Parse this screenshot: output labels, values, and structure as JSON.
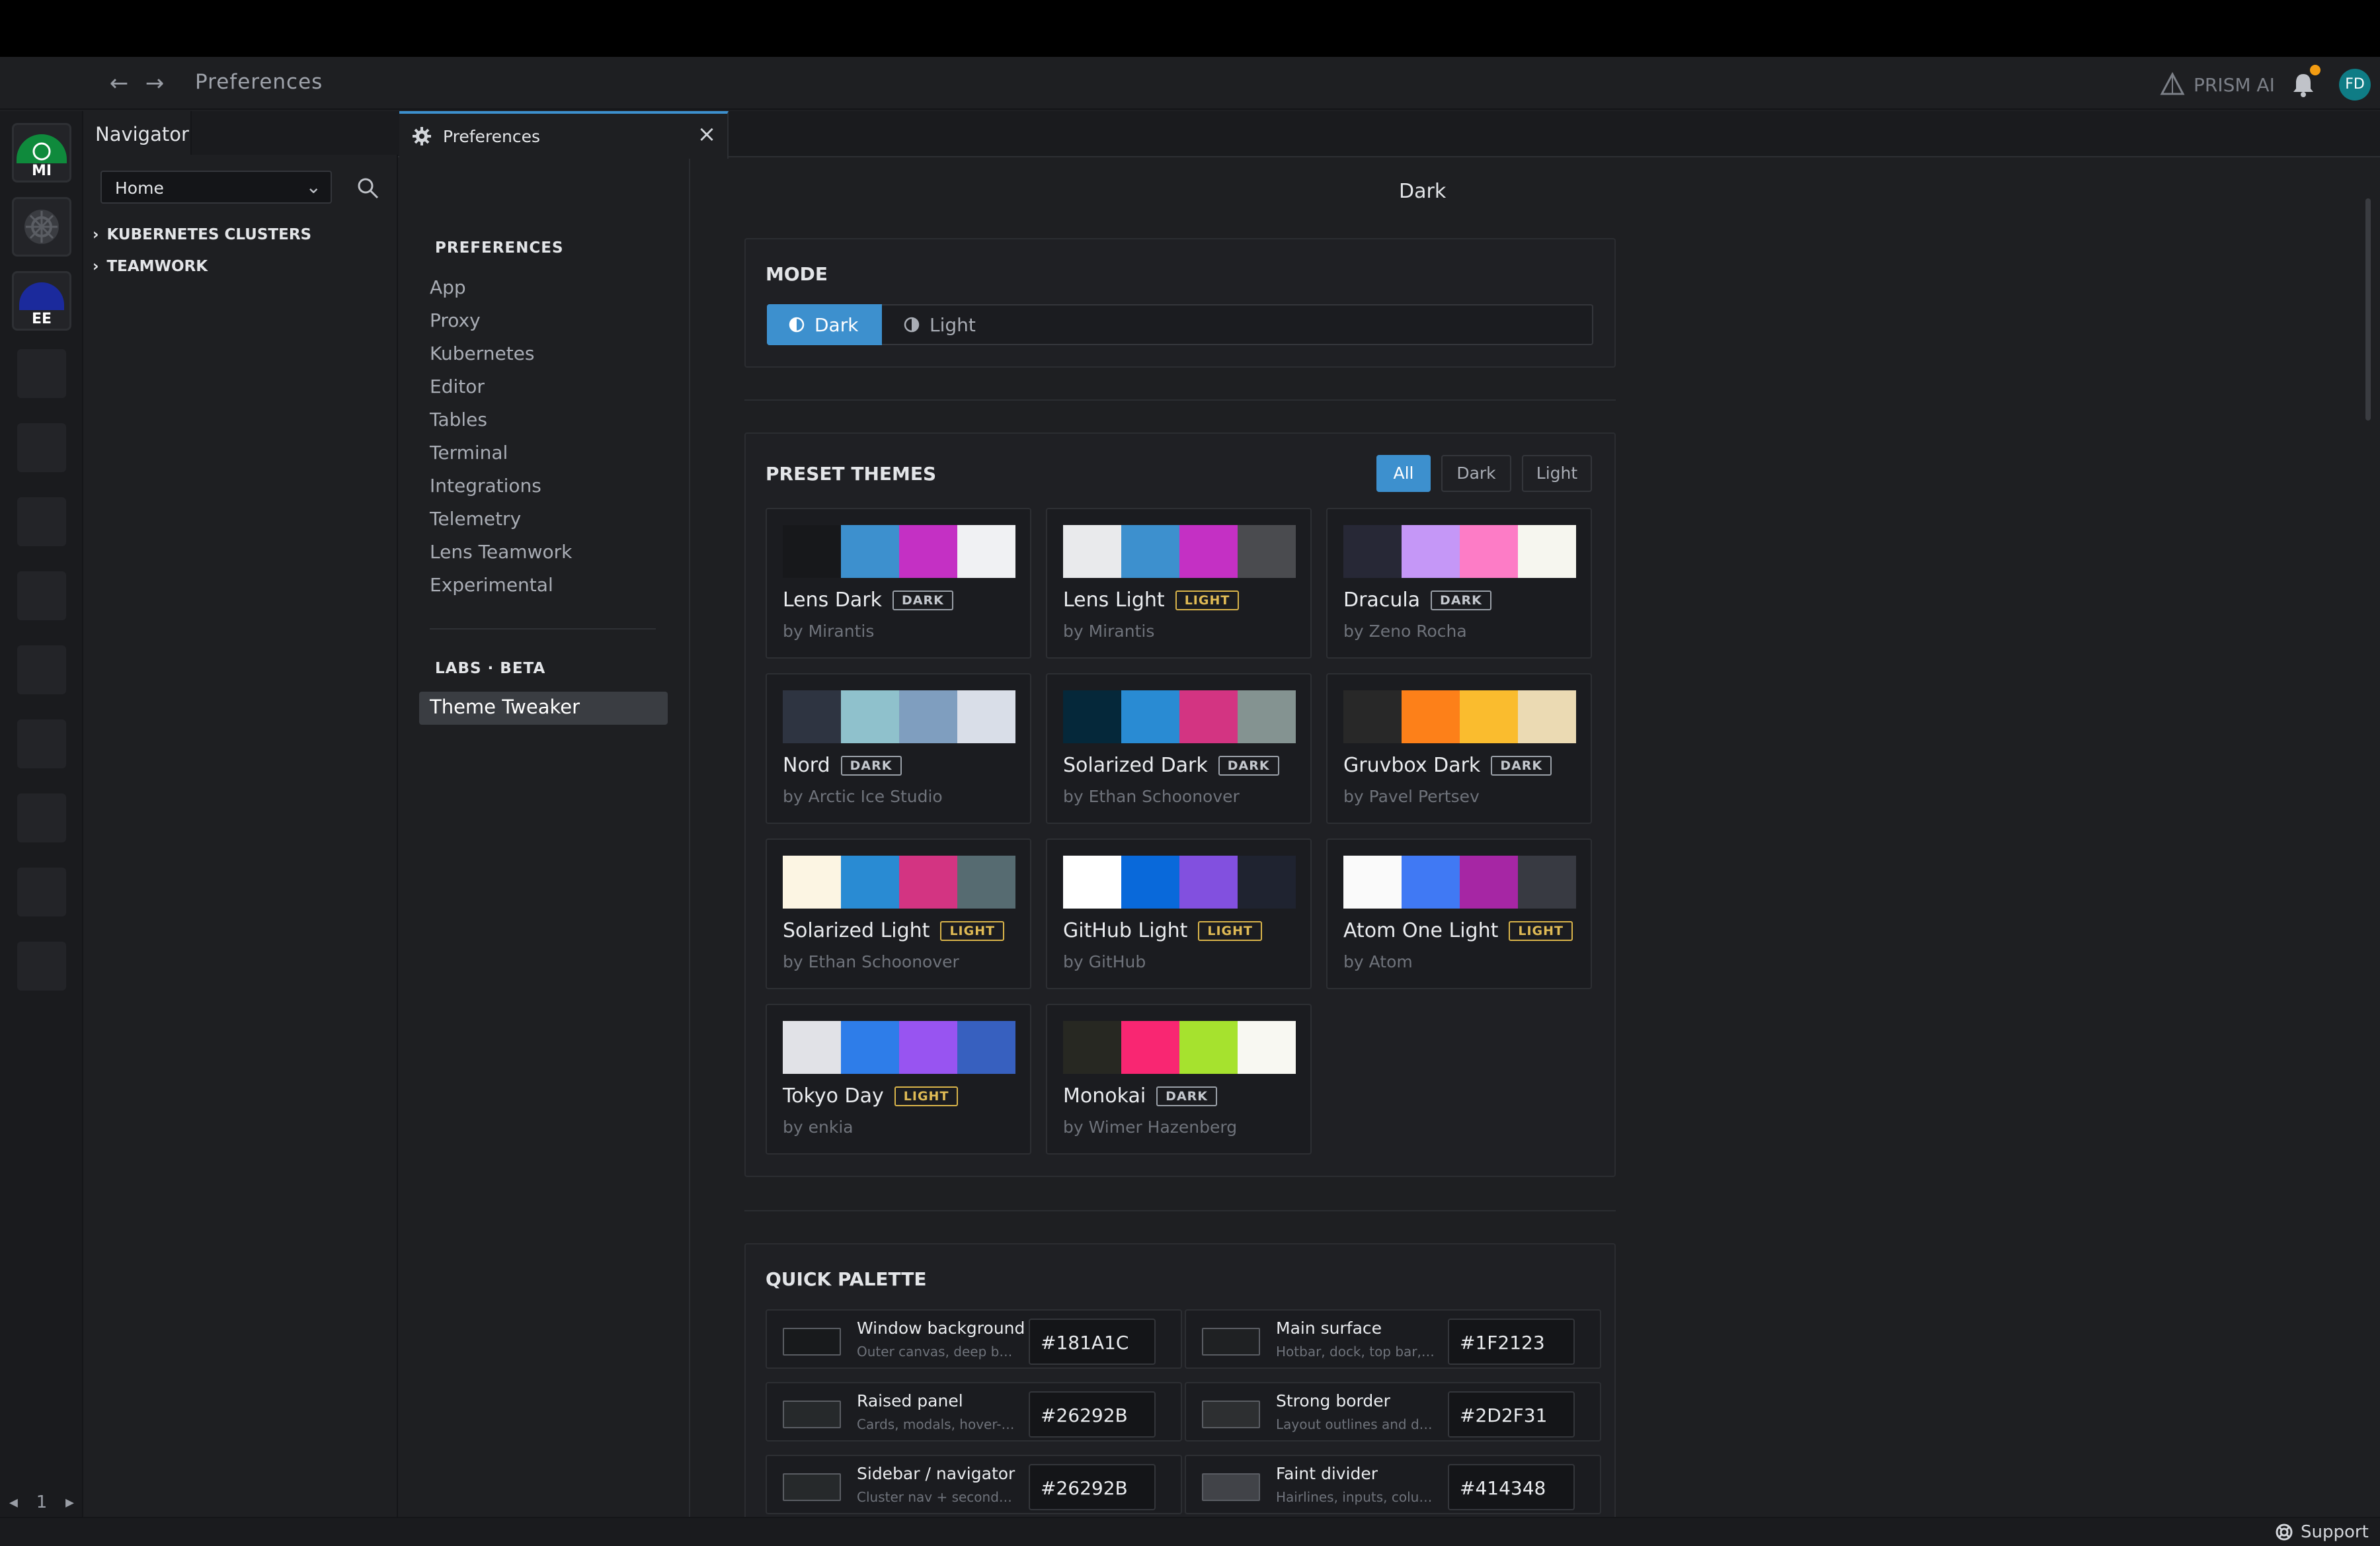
{
  "header": {
    "breadcrumb": "Preferences",
    "ai_label": "PRISM AI",
    "avatar_initials": "FD"
  },
  "hotbar": {
    "items": [
      {
        "label": "MI"
      },
      {
        "label": ""
      },
      {
        "label": "EE"
      }
    ],
    "page": "1"
  },
  "navigator": {
    "tab_label": "Navigator",
    "select_value": "Home",
    "tree": [
      "KUBERNETES CLUSTERS",
      "TEAMWORK"
    ]
  },
  "tab": {
    "label": "Preferences"
  },
  "pref_menu": {
    "section_title": "PREFERENCES",
    "items": [
      "App",
      "Proxy",
      "Kubernetes",
      "Editor",
      "Tables",
      "Terminal",
      "Integrations",
      "Telemetry",
      "Lens Teamwork",
      "Experimental"
    ],
    "labs_title": "LABS · BETA",
    "labs_item": "Theme Tweaker"
  },
  "content": {
    "title": "Dark",
    "mode": {
      "title": "MODE",
      "dark_label": "Dark",
      "light_label": "Light",
      "selected": "Dark"
    },
    "presets": {
      "title": "PRESET THEMES",
      "filters": [
        "All",
        "Dark",
        "Light"
      ],
      "active_filter": "All",
      "themes": [
        {
          "name": "Lens Dark",
          "badge": "DARK",
          "author": "by Mirantis",
          "colors": [
            "#17181b",
            "#3d90ce",
            "#c430c4",
            "#f0f1f3"
          ]
        },
        {
          "name": "Lens Light",
          "badge": "LIGHT",
          "author": "by Mirantis",
          "colors": [
            "#e9eaec",
            "#3d90ce",
            "#c430c4",
            "#4a4b4f"
          ]
        },
        {
          "name": "Dracula",
          "badge": "DARK",
          "author": "by Zeno Rocha",
          "colors": [
            "#272836",
            "#c597f7",
            "#fd7cc6",
            "#f6f6ef"
          ]
        },
        {
          "name": "Nord",
          "badge": "DARK",
          "author": "by Arctic Ice Studio",
          "colors": [
            "#2e3441",
            "#8fc1cc",
            "#7f9ebf",
            "#d9dee8"
          ]
        },
        {
          "name": "Solarized Dark",
          "badge": "DARK",
          "author": "by Ethan Schoonover",
          "colors": [
            "#05283a",
            "#298bd3",
            "#d33482",
            "#849391"
          ]
        },
        {
          "name": "Gruvbox Dark",
          "badge": "DARK",
          "author": "by Pavel Pertsev",
          "colors": [
            "#282828",
            "#fd8019",
            "#fabc2e",
            "#ebdab3"
          ]
        },
        {
          "name": "Solarized Light",
          "badge": "LIGHT",
          "author": "by Ethan Schoonover",
          "colors": [
            "#fcf5e3",
            "#298bd3",
            "#d33482",
            "#566b71"
          ]
        },
        {
          "name": "GitHub Light",
          "badge": "LIGHT",
          "author": "by GitHub",
          "colors": [
            "#ffffff",
            "#0969da",
            "#8250df",
            "#1f2330"
          ]
        },
        {
          "name": "Atom One Light",
          "badge": "LIGHT",
          "author": "by Atom",
          "colors": [
            "#fafafa",
            "#4079f4",
            "#a626a4",
            "#383a42"
          ]
        },
        {
          "name": "Tokyo Day",
          "badge": "LIGHT",
          "author": "by enkia",
          "colors": [
            "#e1e2e7",
            "#2e7de9",
            "#9854f1",
            "#3760bf"
          ]
        },
        {
          "name": "Monokai",
          "badge": "DARK",
          "author": "by Wimer Hazenberg",
          "colors": [
            "#272822",
            "#f92672",
            "#a6e22e",
            "#f8f8f2"
          ]
        }
      ]
    },
    "quick_palette": {
      "title": "QUICK PALETTE",
      "items": [
        {
          "label": "Window background",
          "desc": "Outer canvas, deep beh...",
          "hex": "#181A1C"
        },
        {
          "label": "Main surface",
          "desc": "Hotbar, dock, top bar, t...",
          "hex": "#1F2123"
        },
        {
          "label": "Raised panel",
          "desc": "Cards, modals, hover-fi...",
          "hex": "#26292B"
        },
        {
          "label": "Strong border",
          "desc": "Layout outlines and divi...",
          "hex": "#2D2F31"
        },
        {
          "label": "Sidebar / navigator",
          "desc": "Cluster nav + secondary...",
          "hex": "#26292B"
        },
        {
          "label": "Faint divider",
          "desc": "Hairlines, inputs, colum...",
          "hex": "#414348"
        }
      ]
    }
  },
  "status": {
    "support_label": "Support"
  },
  "colors": {
    "accent": "#3d90ce",
    "notification": "#f39c12",
    "avatar": "#0f7c85"
  }
}
